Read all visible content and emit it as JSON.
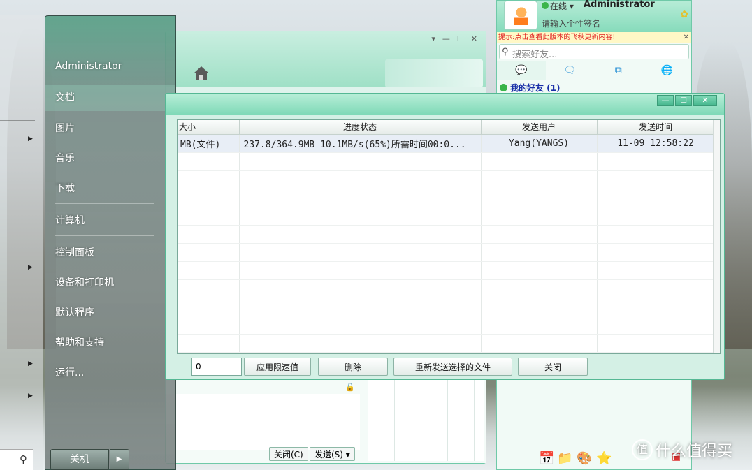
{
  "start_menu": {
    "items": [
      "Administrator",
      "文档",
      "图片",
      "音乐",
      "下载",
      "计算机",
      "控制面板",
      "设备和打印机",
      "默认程序",
      "帮助和支持",
      "运行..."
    ],
    "shutdown_label": "关机"
  },
  "chat_window": {
    "close_label": "关闭(C)",
    "send_label": "发送(S)"
  },
  "qq_panel": {
    "status": "在线",
    "user_name": "Administrator",
    "signature_prompt": "请输入个性签名",
    "notice": "提示:点击查看此版本的飞秋更新内容!",
    "search_placeholder": "搜索好友...",
    "group": "我的好友 (1)"
  },
  "file_transfer": {
    "columns": [
      "大小",
      "进度状态",
      "发送用户",
      "发送时间"
    ],
    "rows": [
      [
        "MB(文件)",
        "237.8/364.9MB 10.1MB/s(65%)所需时间00:0...",
        "Yang(YANGS)",
        "11-09 12:58:22"
      ]
    ],
    "progress_percent": 65,
    "speed_limit_value": "0",
    "buttons": {
      "apply_limit": "应用限速值",
      "delete": "删除",
      "resend": "重新发送选择的文件",
      "close": "关闭"
    }
  },
  "watermark": {
    "badge": "值",
    "text": "什么值得买"
  },
  "colors": {
    "accent": "#7fd9b7",
    "border": "#55b894",
    "notice": "#e02020"
  }
}
